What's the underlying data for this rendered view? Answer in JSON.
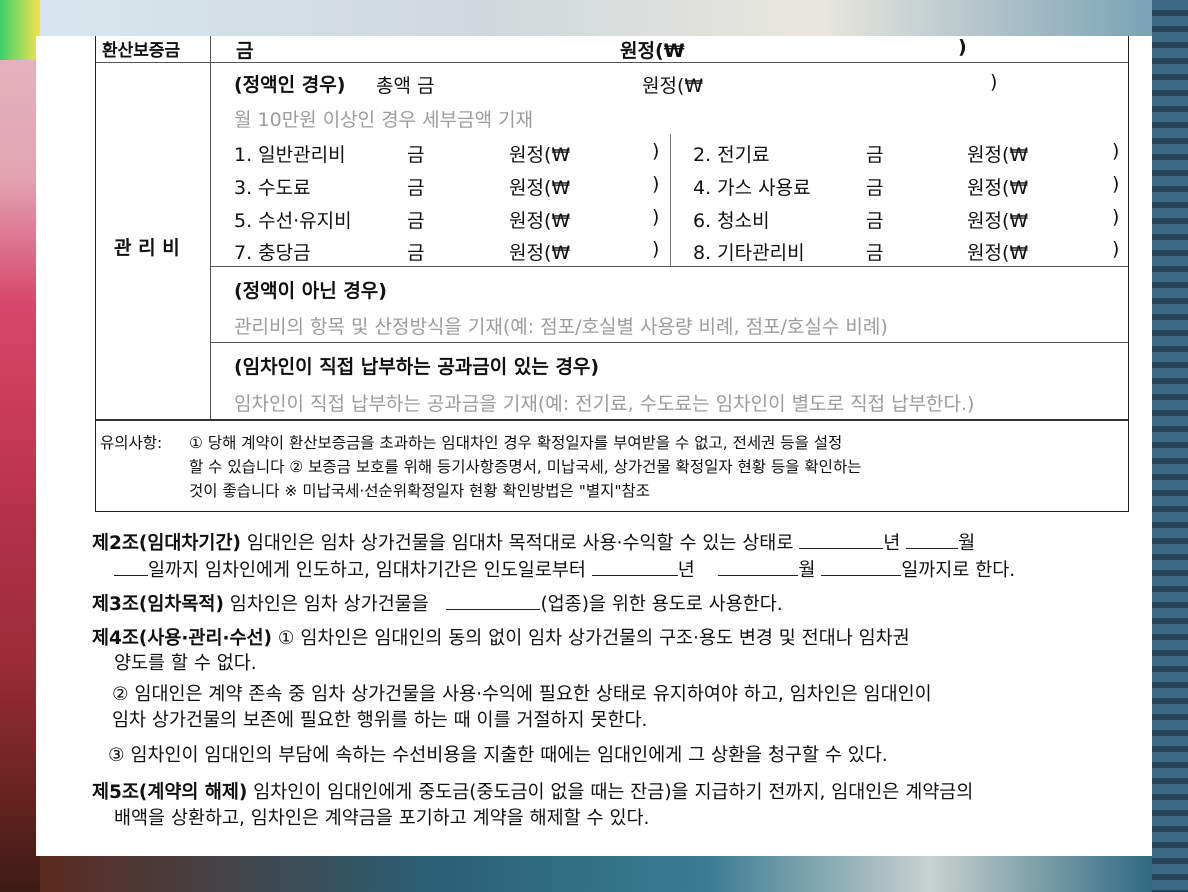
{
  "deposit_row": {
    "label": "환산보증금",
    "prefix": "금",
    "won": "원정(₩",
    "close": ")"
  },
  "mgmt_fee": {
    "label": "관 리 비",
    "fixed_title": "(정액인 경우)",
    "fixed_total": "총액 금",
    "fixed_won": "원정(₩",
    "fixed_close": ")",
    "fixed_note": "월 10만원 이상인 경우 세부금액 기재",
    "items": [
      {
        "label": "1. 일반관리비",
        "geum": "금",
        "won": "원정(₩",
        "close": ")"
      },
      {
        "label": "2. 전기료",
        "geum": "금",
        "won": "원정(₩",
        "close": ")"
      },
      {
        "label": "3. 수도료",
        "geum": "금",
        "won": "원정(₩",
        "close": ")"
      },
      {
        "label": "4. 가스 사용료",
        "geum": "금",
        "won": "원정(₩",
        "close": ")"
      },
      {
        "label": "5. 수선·유지비",
        "geum": "금",
        "won": "원정(₩",
        "close": ")"
      },
      {
        "label": "6. 청소비",
        "geum": "금",
        "won": "원정(₩",
        "close": ")"
      },
      {
        "label": "7. 충당금",
        "geum": "금",
        "won": "원정(₩",
        "close": ")"
      },
      {
        "label": "8. 기타관리비",
        "geum": "금",
        "won": "원정(₩",
        "close": ")"
      }
    ],
    "nonfixed_title": "(정액이 아닌 경우)",
    "nonfixed_note": "관리비의 항목 및 산정방식을 기재(예: 점포/호실별 사용량 비례, 점포/호실수 비례)",
    "direct_title": "(임차인이 직접 납부하는 공과금이 있는 경우)",
    "direct_note": "임차인이 직접 납부하는 공과금을 기재(예: 전기료, 수도료는 임차인이 별도로 직접 납부한다.)"
  },
  "notice": {
    "label": "유의사항:",
    "line1": "① 당해 계약이 환산보증금을 초과하는 임대차인 경우 확정일자를 부여받을 수 없고, 전세권 등을 설정",
    "line2": "할 수 있습니다 ② 보증금 보호를 위해 등기사항증명서, 미납국세, 상가건물 확정일자 현황 등을 확인하는",
    "line3": "것이 좋습니다 ※ 미납국세·선순위확정일자 현황 확인방법은 \"별지\"참조"
  },
  "articles": {
    "a2_title": "제2조(임대차기간)",
    "a2_l1": "임대인은 임차 상가건물을 임대차 목적대로 사용·수익할 수 있는 상태로",
    "a2_year": "년",
    "a2_month": "월",
    "a2_l2a": "일까지 임차인에게 인도하고, 임대차기간은 인도일로부터",
    "a2_l2_year": "년",
    "a2_l2_month": "월",
    "a2_l2_end": "일까지로 한다.",
    "a3_title": "제3조(임차목적)",
    "a3_l1": "임차인은 임차 상가건물을",
    "a3_l1b": "(업종)을 위한 용도로 사용한다.",
    "a4_title": "제4조(사용·관리·수선)",
    "a4_l1": "① 임차인은 임대인의 동의 없이 임차 상가건물의 구조·용도 변경 및 전대나 임차권",
    "a4_l2": "양도를 할 수 없다.",
    "a4_l3": "② 임대인은 계약 존속 중 임차 상가건물을 사용·수익에 필요한 상태로 유지하여야 하고, 임차인은 임대인이",
    "a4_l4": "임차 상가건물의 보존에 필요한 행위를 하는 때 이를 거절하지 못한다.",
    "a4_l5": "③ 임차인이 임대인의 부담에 속하는 수선비용을 지출한 때에는 임대인에게 그 상환을 청구할 수 있다.",
    "a5_title": "제5조(계약의 해제)",
    "a5_l1": "임차인이 임대인에게 중도금(중도금이 없을 때는 잔금)을 지급하기 전까지, 임대인은 계약금의",
    "a5_l2": "배액을 상환하고, 임차인은 계약금을 포기하고 계약을 해제할 수 있다."
  }
}
